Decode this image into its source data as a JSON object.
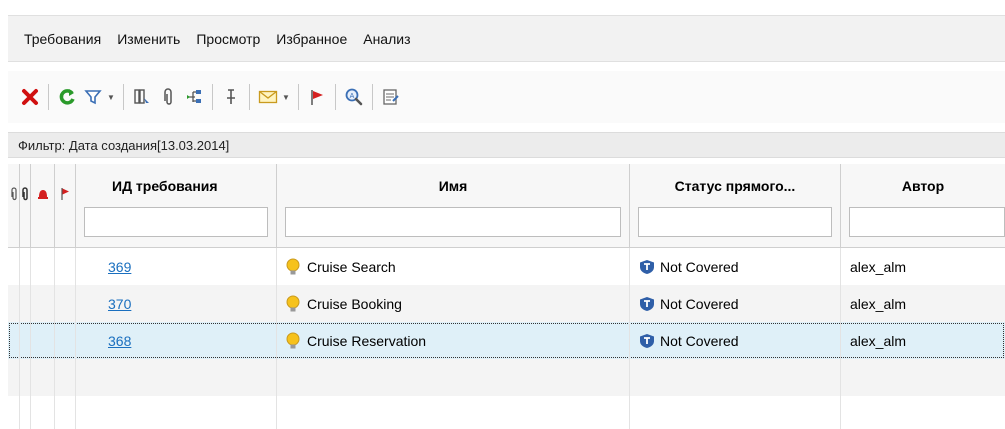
{
  "menu": {
    "items": [
      "Требования",
      "Изменить",
      "Просмотр",
      "Избранное",
      "Анализ"
    ]
  },
  "toolbar": {
    "icons": [
      "delete-icon",
      "refresh-icon",
      "filter-icon",
      "columns-icon",
      "attachment-icon",
      "tree-icon",
      "pin-icon",
      "mail-icon",
      "flag-icon",
      "find-icon",
      "notes-icon"
    ]
  },
  "filter": {
    "text": "Фильтр: Дата создания[13.03.2014]"
  },
  "grid": {
    "columns": [
      "ИД требования",
      "Имя",
      "Статус прямого...",
      "Автор"
    ],
    "rows": [
      {
        "id": "369",
        "name": "Cruise Search",
        "status": "Not Covered",
        "author": "alex_alm"
      },
      {
        "id": "370",
        "name": "Cruise Booking",
        "status": "Not Covered",
        "author": "alex_alm"
      },
      {
        "id": "368",
        "name": "Cruise Reservation",
        "status": "Not Covered",
        "author": "alex_alm"
      }
    ]
  },
  "colors": {
    "link": "#1a6fbf",
    "selection": "#dff0f8",
    "flag": "#d42020"
  }
}
